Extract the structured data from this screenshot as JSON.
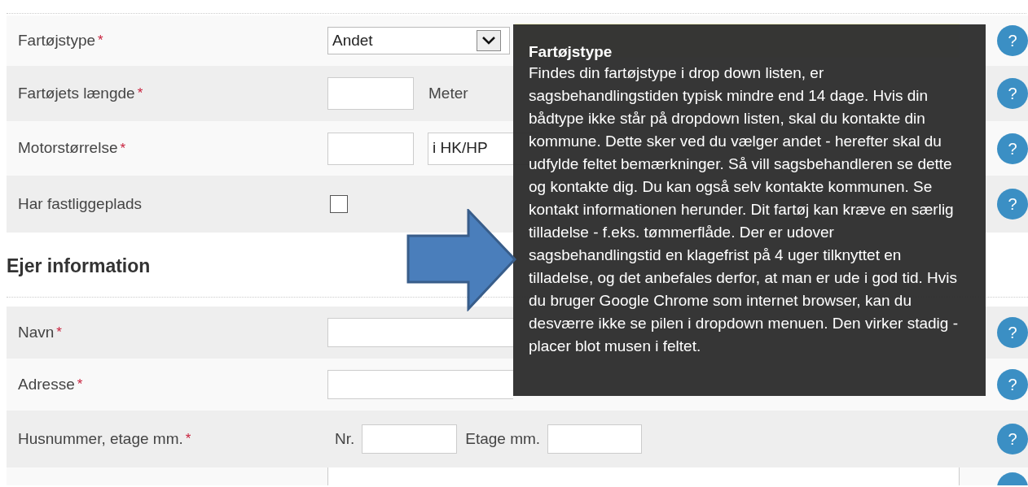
{
  "vessel_rows": [
    {
      "kind": "select",
      "label": "Fartøjstype",
      "required_mark": "*",
      "value": "Andet",
      "help": "?"
    },
    {
      "kind": "input_unit",
      "label": "Fartøjets længde",
      "required_mark": "*",
      "unit": "Meter",
      "help": "?"
    },
    {
      "kind": "input_select",
      "label": "Motorstørrelse",
      "required_mark": "*",
      "value": "i HK/HP",
      "help": "?"
    },
    {
      "kind": "checkbox",
      "label": "Har fastliggeplads",
      "checked": false,
      "help": "?"
    }
  ],
  "owner_heading": "Ejer information",
  "owner_rows": [
    {
      "kind": "text",
      "label": "Navn",
      "required_mark": "*",
      "help": "?"
    },
    {
      "kind": "text",
      "label": "Adresse",
      "required_mark": "*",
      "help": "?"
    },
    {
      "kind": "parts",
      "label": "Husnummer, etage mm.",
      "required_mark": "*",
      "parts": [
        "Nr.",
        "Etage mm."
      ],
      "help": "?"
    },
    {
      "kind": "text"
    }
  ],
  "tooltip": {
    "title": "Fartøjstype",
    "text": "Findes din fartøjstype i drop down listen, er sagsbehandlingstiden typisk mindre end 14 dage. Hvis din bådtype ikke står på dropdown listen, skal du kontakte din kommune. Dette sker ved du vælger andet - herefter skal du udfylde feltet bemærkninger. Så vill sagsbehandleren se dette og kontakte dig. Du kan også selv kontakte kommunen. Se kontakt informationen herunder. Dit fartøj kan kræve en særlig tilladelse - f.eks. tømmerflåde. Der er udover sagsbehandlingstid en klagefrist på 4 uger tilknyttet en tilladelse, og det anbefales derfor, at man er ude i god tid. Hvis du bruger Google Chrome som internet browser, kan du desværre ikke se pilen i dropdown menuen. Den virker stadig - placer blot musen i feltet."
  }
}
